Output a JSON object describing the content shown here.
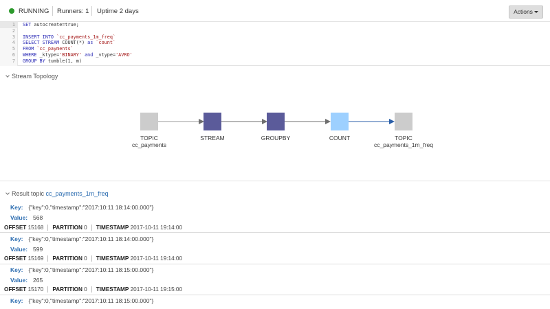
{
  "status": {
    "state": "RUNNING",
    "state_color": "#2c9a2c",
    "runners": "Runners: 1",
    "uptime": "Uptime 2 days",
    "actions_label": "Actions"
  },
  "editor": {
    "line_numbers": [
      "1",
      "2",
      "3",
      "4",
      "5",
      "6",
      "7"
    ]
  },
  "topology": {
    "title": "Stream Topology",
    "nodes": [
      {
        "type": "TOPIC",
        "name": "cc_payments",
        "color": "#cccccc"
      },
      {
        "type": "STREAM",
        "name": "",
        "color": "#5b5b9a"
      },
      {
        "type": "GROUPBY",
        "name": "",
        "color": "#5b5b9a"
      },
      {
        "type": "COUNT",
        "name": "",
        "color": "#9dd0ff"
      },
      {
        "type": "TOPIC",
        "name": "cc_payments_1m_freq",
        "color": "#cccccc"
      }
    ]
  },
  "results": {
    "title_prefix": "Result topic",
    "topic_name": "cc_payments_1m_freq",
    "key_label": "Key:",
    "value_label": "Value:",
    "offset_label": "OFFSET",
    "partition_label": "PARTITION",
    "timestamp_label": "TIMESTAMP",
    "records": [
      {
        "key": "{\"key\":0,\"timestamp\":\"2017:10:11 18:14:00.000\"}",
        "value": "568",
        "offset": "15168",
        "partition": "0",
        "timestamp": "2017-10-11 19:14:00"
      },
      {
        "key": "{\"key\":0,\"timestamp\":\"2017:10:11 18:14:00.000\"}",
        "value": "599",
        "offset": "15169",
        "partition": "0",
        "timestamp": "2017-10-11 19:14:00"
      },
      {
        "key": "{\"key\":0,\"timestamp\":\"2017:10:11 18:15:00.000\"}",
        "value": "265",
        "offset": "15170",
        "partition": "0",
        "timestamp": "2017-10-11 19:15:00"
      },
      {
        "key": "{\"key\":0,\"timestamp\":\"2017:10:11 18:15:00.000\"}",
        "value": "",
        "offset": "",
        "partition": "",
        "timestamp": ""
      }
    ]
  }
}
